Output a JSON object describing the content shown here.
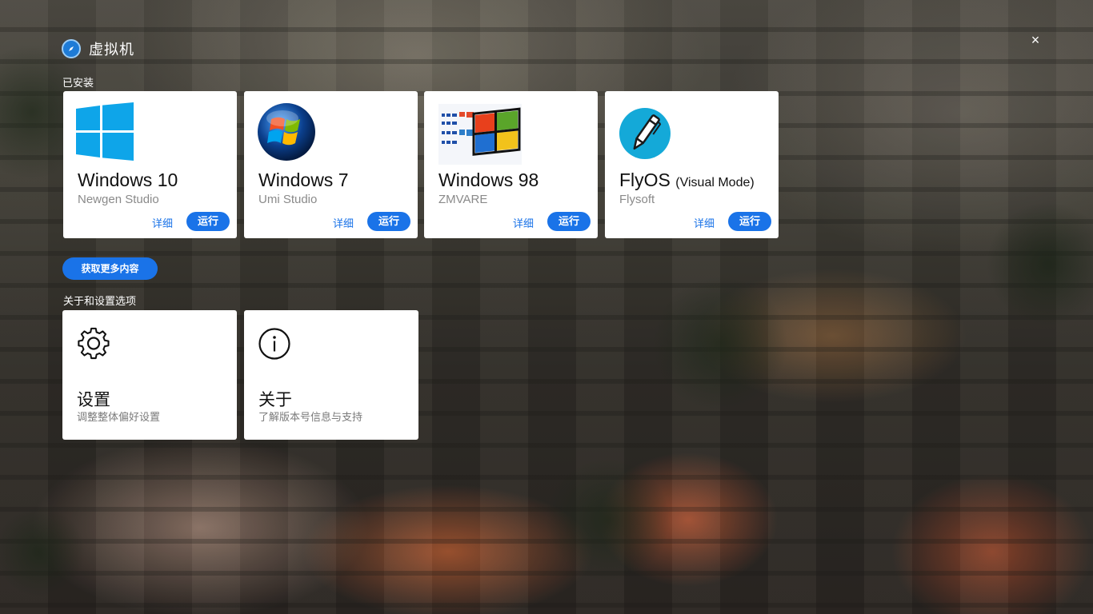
{
  "app": {
    "title": "虚拟机",
    "close_glyph": "×"
  },
  "installed": {
    "heading": "已安装",
    "vms": [
      {
        "name": "Windows 10",
        "mode": "",
        "vendor": "Newgen Studio",
        "icon": "windows-10-logo-icon",
        "detail_label": "详细",
        "run_label": "运行"
      },
      {
        "name": "Windows 7",
        "mode": "",
        "vendor": "Umi Studio",
        "icon": "windows-7-logo-icon",
        "detail_label": "详细",
        "run_label": "运行"
      },
      {
        "name": "Windows 98",
        "mode": "",
        "vendor": "ZMVARE",
        "icon": "windows-98-logo-icon",
        "detail_label": "详细",
        "run_label": "运行"
      },
      {
        "name": "FlyOS",
        "mode": "(Visual Mode)",
        "vendor": "Flysoft",
        "icon": "flyos-pen-icon",
        "detail_label": "详细",
        "run_label": "运行"
      }
    ]
  },
  "get_more": {
    "label": "获取更多内容"
  },
  "options": {
    "heading": "关于和设置选项",
    "items": [
      {
        "title": "设置",
        "description": "调整整体偏好设置",
        "icon": "gear-icon"
      },
      {
        "title": "关于",
        "description": "了解版本号信息与支持",
        "icon": "info-icon"
      }
    ]
  },
  "colors": {
    "accent": "#1a73e8",
    "card_bg": "#ffffff",
    "vendor_text": "#8a8a8a"
  }
}
